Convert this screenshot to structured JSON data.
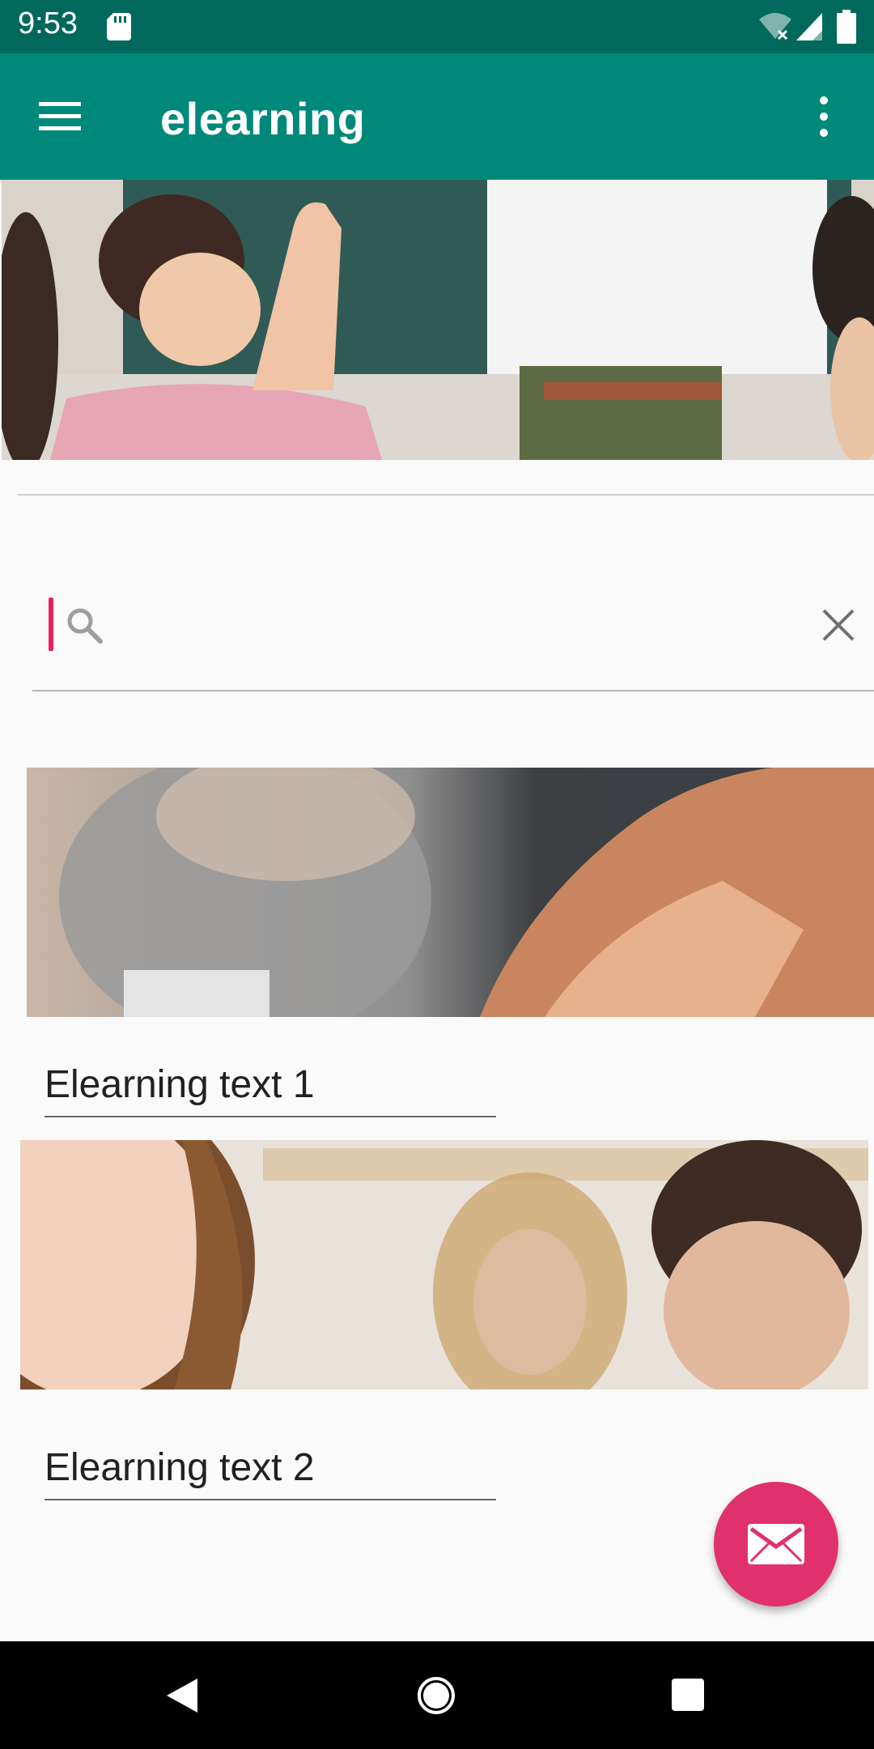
{
  "status_bar": {
    "time": "9:53",
    "icons": [
      "sd-card-icon",
      "wifi-off-icon",
      "signal-icon",
      "battery-icon"
    ]
  },
  "app_bar": {
    "title": "elearning",
    "icons": [
      "menu-icon",
      "more-vert-icon"
    ],
    "color": "#00897b"
  },
  "search": {
    "value": "",
    "placeholder": "",
    "icons": [
      "search-icon",
      "close-icon"
    ]
  },
  "cards": [
    {
      "text": "Elearning text 1",
      "image": "classroom-raised-hand-photo"
    },
    {
      "text": "Elearning text 2",
      "image": "students-classroom-photo"
    }
  ],
  "fab": {
    "icon": "mail-icon",
    "color": "#e0316e"
  },
  "nav_bar": {
    "icons": [
      "back-icon",
      "home-icon",
      "recents-icon"
    ]
  }
}
